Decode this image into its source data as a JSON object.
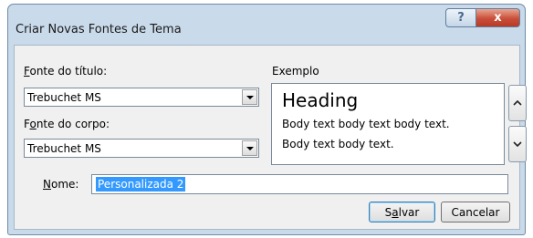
{
  "window": {
    "title": "Criar Novas Fontes de Tema",
    "help_label": "?",
    "close_label": "x"
  },
  "heading_font": {
    "label_accel": "F",
    "label_rest": "onte do título:",
    "value": "Trebuchet MS"
  },
  "body_font": {
    "label_pre": "F",
    "label_accel": "o",
    "label_rest": "nte do corpo:",
    "value": "Trebuchet MS"
  },
  "preview": {
    "label": "Exemplo",
    "heading": "Heading",
    "body_line_1": "Body text body text body text.",
    "body_line_2": "Body text body text."
  },
  "name": {
    "label_accel": "N",
    "label_rest": "ome:",
    "value": "Personalizada 2"
  },
  "buttons": {
    "save_pre": "S",
    "save_accel": "a",
    "save_rest": "lvar",
    "cancel": "Cancelar"
  }
}
